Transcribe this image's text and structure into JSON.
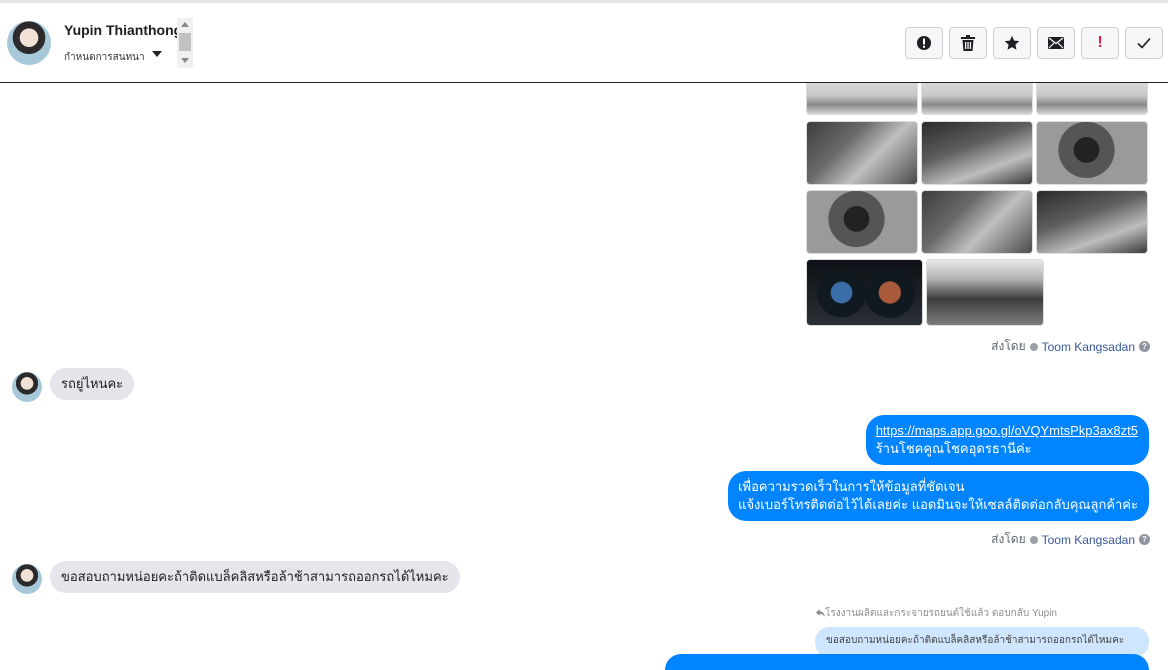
{
  "header": {
    "contact_name": "Yupin Thianthong",
    "conversation_label": "กำหนดการสนทนา",
    "actions": [
      {
        "name": "alert-icon"
      },
      {
        "name": "trash-icon"
      },
      {
        "name": "star-icon"
      },
      {
        "name": "mail-icon"
      },
      {
        "name": "exclamation-icon",
        "label": "!"
      },
      {
        "name": "check-icon"
      }
    ]
  },
  "thread": {
    "sent_by_label": "ส่งโดย",
    "sender_name": "Toom Kangsadan",
    "messages": [
      {
        "from": "customer",
        "text": "รถยู่ไหนคะ"
      },
      {
        "from": "page",
        "link": "https://maps.app.goo.gl/oVQYmtsPkp3ax8zt5",
        "text": "ร้านโชคคูณโชคอุดรธานีค่ะ"
      },
      {
        "from": "page",
        "line1": "เพื่อความรวดเร็วในการให้ข้อมูลที่ชัดเจน",
        "line2": "แจ้งเบอร์โทรติดต่อไว้ได้เลยค่ะ แอดมินจะให้เซลล์ติดต่อกลับคุณลูกค้าค่ะ"
      },
      {
        "from": "customer",
        "text": "ขอสอบถามหน่อยคะถ้าติดแบล็คลิสหรือล้าช้าสามารถออกรถได้ไหมคะ"
      }
    ],
    "reply_note": "โรงงานผลิตและกระจายรถยนต์ใช้แล้ว ตอบกลับ Yupin",
    "reply_quote": "ขอสอบถามหน่อยคะถ้าติดแบล็คลิสหรือล้าช้าสามารถออกรถได้ไหมคะ"
  },
  "colors": {
    "outgoing_bubble": "#0084ff",
    "incoming_bubble": "#e4e6eb",
    "link_name": "#385898"
  }
}
